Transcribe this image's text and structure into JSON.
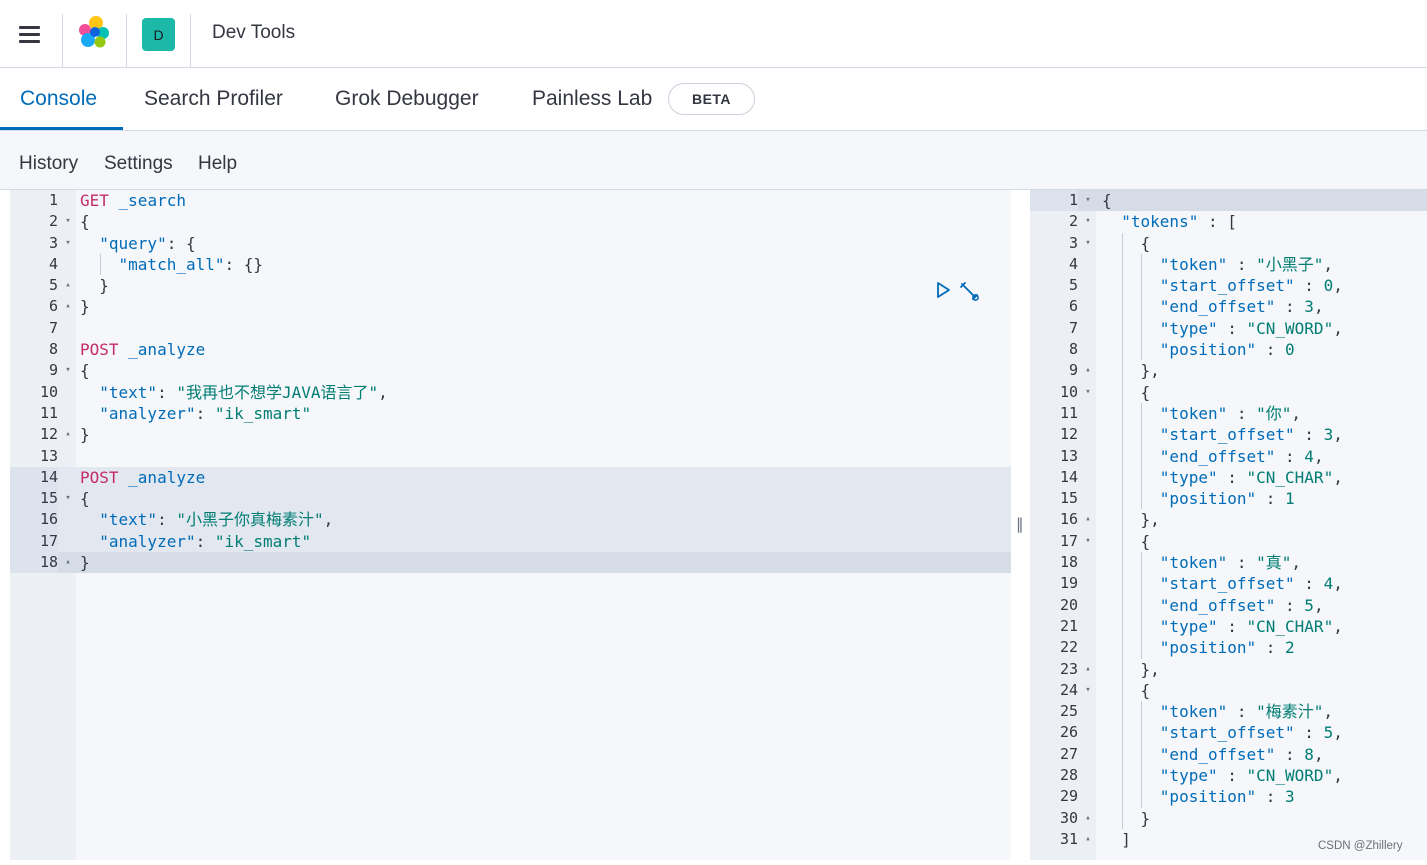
{
  "header": {
    "space_initial": "D",
    "breadcrumb": "Dev Tools",
    "icons": {
      "menu": "hamburger-menu-icon",
      "logo": "elastic-logo-icon"
    }
  },
  "tabs": [
    {
      "label": "Console",
      "active": true
    },
    {
      "label": "Search Profiler",
      "active": false
    },
    {
      "label": "Grok Debugger",
      "active": false
    },
    {
      "label": "Painless Lab",
      "active": false
    }
  ],
  "beta_badge": "BETA",
  "menu": {
    "history": "History",
    "settings": "Settings",
    "help": "Help"
  },
  "request_editor": {
    "lines": [
      {
        "n": "1",
        "fold": "",
        "segs": [
          [
            "m",
            "GET"
          ],
          [
            "p",
            " _search"
          ]
        ]
      },
      {
        "n": "2",
        "fold": "▾",
        "segs": [
          [
            "c",
            "{"
          ]
        ]
      },
      {
        "n": "3",
        "fold": "▾",
        "segs": [
          [
            "c",
            "  "
          ],
          [
            "k",
            "\"query\""
          ],
          [
            "c",
            ": {"
          ]
        ]
      },
      {
        "n": "4",
        "fold": "",
        "guide": true,
        "segs": [
          [
            "c",
            "    "
          ],
          [
            "k",
            "\"match_all\""
          ],
          [
            "c",
            ": {}"
          ]
        ]
      },
      {
        "n": "5",
        "fold": "▴",
        "segs": [
          [
            "c",
            "  }"
          ]
        ]
      },
      {
        "n": "6",
        "fold": "▴",
        "segs": [
          [
            "c",
            "}"
          ]
        ]
      },
      {
        "n": "7",
        "fold": "",
        "segs": []
      },
      {
        "n": "8",
        "fold": "",
        "segs": [
          [
            "m",
            "POST"
          ],
          [
            "p",
            " _analyze"
          ]
        ]
      },
      {
        "n": "9",
        "fold": "▾",
        "segs": [
          [
            "c",
            "{"
          ]
        ]
      },
      {
        "n": "10",
        "fold": "",
        "segs": [
          [
            "c",
            "  "
          ],
          [
            "k",
            "\"text\""
          ],
          [
            "c",
            ": "
          ],
          [
            "s",
            "\"我再也不想学JAVA语言了\""
          ],
          [
            "c",
            ","
          ]
        ]
      },
      {
        "n": "11",
        "fold": "",
        "segs": [
          [
            "c",
            "  "
          ],
          [
            "k",
            "\"analyzer\""
          ],
          [
            "c",
            ": "
          ],
          [
            "s",
            "\"ik_smart\""
          ]
        ]
      },
      {
        "n": "12",
        "fold": "▴",
        "segs": [
          [
            "c",
            "}"
          ]
        ]
      },
      {
        "n": "13",
        "fold": "",
        "segs": []
      },
      {
        "n": "14",
        "fold": "",
        "hl": true,
        "segs": [
          [
            "m",
            "POST"
          ],
          [
            "p",
            " _analyze"
          ]
        ]
      },
      {
        "n": "15",
        "fold": "▾",
        "hl": true,
        "segs": [
          [
            "c",
            "{"
          ]
        ]
      },
      {
        "n": "16",
        "fold": "",
        "hl": true,
        "segs": [
          [
            "c",
            "  "
          ],
          [
            "k",
            "\"text\""
          ],
          [
            "c",
            ": "
          ],
          [
            "s",
            "\"小黑子你真梅素汁\""
          ],
          [
            "c",
            ","
          ]
        ]
      },
      {
        "n": "17",
        "fold": "",
        "hl": true,
        "segs": [
          [
            "c",
            "  "
          ],
          [
            "k",
            "\"analyzer\""
          ],
          [
            "c",
            ": "
          ],
          [
            "s",
            "\"ik_smart\""
          ]
        ]
      },
      {
        "n": "18",
        "fold": "▴",
        "hl2": true,
        "segs": [
          [
            "c",
            "}"
          ]
        ]
      }
    ],
    "icons": {
      "run": "play-icon",
      "settings": "wrench-icon"
    }
  },
  "response_editor": {
    "lines": [
      {
        "n": "1",
        "fold": "▾",
        "hl2": true,
        "segs": [
          [
            "c",
            "{"
          ]
        ]
      },
      {
        "n": "2",
        "fold": "▾",
        "segs": [
          [
            "c",
            "  "
          ],
          [
            "k",
            "\"tokens\""
          ],
          [
            "c",
            " : ["
          ]
        ]
      },
      {
        "n": "3",
        "fold": "▾",
        "segs": [
          [
            "c",
            "    {"
          ]
        ]
      },
      {
        "n": "4",
        "fold": "",
        "segs": [
          [
            "c",
            "      "
          ],
          [
            "k",
            "\"token\""
          ],
          [
            "c",
            " : "
          ],
          [
            "s",
            "\"小黑子\""
          ],
          [
            "c",
            ","
          ]
        ]
      },
      {
        "n": "5",
        "fold": "",
        "segs": [
          [
            "c",
            "      "
          ],
          [
            "k",
            "\"start_offset\""
          ],
          [
            "c",
            " : "
          ],
          [
            "s",
            "0"
          ],
          [
            "c",
            ","
          ]
        ]
      },
      {
        "n": "6",
        "fold": "",
        "segs": [
          [
            "c",
            "      "
          ],
          [
            "k",
            "\"end_offset\""
          ],
          [
            "c",
            " : "
          ],
          [
            "s",
            "3"
          ],
          [
            "c",
            ","
          ]
        ]
      },
      {
        "n": "7",
        "fold": "",
        "segs": [
          [
            "c",
            "      "
          ],
          [
            "k",
            "\"type\""
          ],
          [
            "c",
            " : "
          ],
          [
            "s",
            "\"CN_WORD\""
          ],
          [
            "c",
            ","
          ]
        ]
      },
      {
        "n": "8",
        "fold": "",
        "segs": [
          [
            "c",
            "      "
          ],
          [
            "k",
            "\"position\""
          ],
          [
            "c",
            " : "
          ],
          [
            "s",
            "0"
          ]
        ]
      },
      {
        "n": "9",
        "fold": "▴",
        "segs": [
          [
            "c",
            "    },"
          ]
        ]
      },
      {
        "n": "10",
        "fold": "▾",
        "segs": [
          [
            "c",
            "    {"
          ]
        ]
      },
      {
        "n": "11",
        "fold": "",
        "segs": [
          [
            "c",
            "      "
          ],
          [
            "k",
            "\"token\""
          ],
          [
            "c",
            " : "
          ],
          [
            "s",
            "\"你\""
          ],
          [
            "c",
            ","
          ]
        ]
      },
      {
        "n": "12",
        "fold": "",
        "segs": [
          [
            "c",
            "      "
          ],
          [
            "k",
            "\"start_offset\""
          ],
          [
            "c",
            " : "
          ],
          [
            "s",
            "3"
          ],
          [
            "c",
            ","
          ]
        ]
      },
      {
        "n": "13",
        "fold": "",
        "segs": [
          [
            "c",
            "      "
          ],
          [
            "k",
            "\"end_offset\""
          ],
          [
            "c",
            " : "
          ],
          [
            "s",
            "4"
          ],
          [
            "c",
            ","
          ]
        ]
      },
      {
        "n": "14",
        "fold": "",
        "segs": [
          [
            "c",
            "      "
          ],
          [
            "k",
            "\"type\""
          ],
          [
            "c",
            " : "
          ],
          [
            "s",
            "\"CN_CHAR\""
          ],
          [
            "c",
            ","
          ]
        ]
      },
      {
        "n": "15",
        "fold": "",
        "segs": [
          [
            "c",
            "      "
          ],
          [
            "k",
            "\"position\""
          ],
          [
            "c",
            " : "
          ],
          [
            "s",
            "1"
          ]
        ]
      },
      {
        "n": "16",
        "fold": "▴",
        "segs": [
          [
            "c",
            "    },"
          ]
        ]
      },
      {
        "n": "17",
        "fold": "▾",
        "segs": [
          [
            "c",
            "    {"
          ]
        ]
      },
      {
        "n": "18",
        "fold": "",
        "segs": [
          [
            "c",
            "      "
          ],
          [
            "k",
            "\"token\""
          ],
          [
            "c",
            " : "
          ],
          [
            "s",
            "\"真\""
          ],
          [
            "c",
            ","
          ]
        ]
      },
      {
        "n": "19",
        "fold": "",
        "segs": [
          [
            "c",
            "      "
          ],
          [
            "k",
            "\"start_offset\""
          ],
          [
            "c",
            " : "
          ],
          [
            "s",
            "4"
          ],
          [
            "c",
            ","
          ]
        ]
      },
      {
        "n": "20",
        "fold": "",
        "segs": [
          [
            "c",
            "      "
          ],
          [
            "k",
            "\"end_offset\""
          ],
          [
            "c",
            " : "
          ],
          [
            "s",
            "5"
          ],
          [
            "c",
            ","
          ]
        ]
      },
      {
        "n": "21",
        "fold": "",
        "segs": [
          [
            "c",
            "      "
          ],
          [
            "k",
            "\"type\""
          ],
          [
            "c",
            " : "
          ],
          [
            "s",
            "\"CN_CHAR\""
          ],
          [
            "c",
            ","
          ]
        ]
      },
      {
        "n": "22",
        "fold": "",
        "segs": [
          [
            "c",
            "      "
          ],
          [
            "k",
            "\"position\""
          ],
          [
            "c",
            " : "
          ],
          [
            "s",
            "2"
          ]
        ]
      },
      {
        "n": "23",
        "fold": "▴",
        "segs": [
          [
            "c",
            "    },"
          ]
        ]
      },
      {
        "n": "24",
        "fold": "▾",
        "segs": [
          [
            "c",
            "    {"
          ]
        ]
      },
      {
        "n": "25",
        "fold": "",
        "segs": [
          [
            "c",
            "      "
          ],
          [
            "k",
            "\"token\""
          ],
          [
            "c",
            " : "
          ],
          [
            "s",
            "\"梅素汁\""
          ],
          [
            "c",
            ","
          ]
        ]
      },
      {
        "n": "26",
        "fold": "",
        "segs": [
          [
            "c",
            "      "
          ],
          [
            "k",
            "\"start_offset\""
          ],
          [
            "c",
            " : "
          ],
          [
            "s",
            "5"
          ],
          [
            "c",
            ","
          ]
        ]
      },
      {
        "n": "27",
        "fold": "",
        "segs": [
          [
            "c",
            "      "
          ],
          [
            "k",
            "\"end_offset\""
          ],
          [
            "c",
            " : "
          ],
          [
            "s",
            "8"
          ],
          [
            "c",
            ","
          ]
        ]
      },
      {
        "n": "28",
        "fold": "",
        "segs": [
          [
            "c",
            "      "
          ],
          [
            "k",
            "\"type\""
          ],
          [
            "c",
            " : "
          ],
          [
            "s",
            "\"CN_WORD\""
          ],
          [
            "c",
            ","
          ]
        ]
      },
      {
        "n": "29",
        "fold": "",
        "segs": [
          [
            "c",
            "      "
          ],
          [
            "k",
            "\"position\""
          ],
          [
            "c",
            " : "
          ],
          [
            "s",
            "3"
          ]
        ]
      },
      {
        "n": "30",
        "fold": "▴",
        "segs": [
          [
            "c",
            "    }"
          ]
        ]
      },
      {
        "n": "31",
        "fold": "▴",
        "segs": [
          [
            "c",
            "  ]"
          ]
        ]
      }
    ]
  },
  "resizer_glyph": "‖",
  "watermark": "CSDN @Zhillery",
  "colors": {
    "accent": "#006bb8",
    "method": "#c42b6b",
    "string": "#017d73",
    "space_avatar": "#1cb8a8"
  }
}
